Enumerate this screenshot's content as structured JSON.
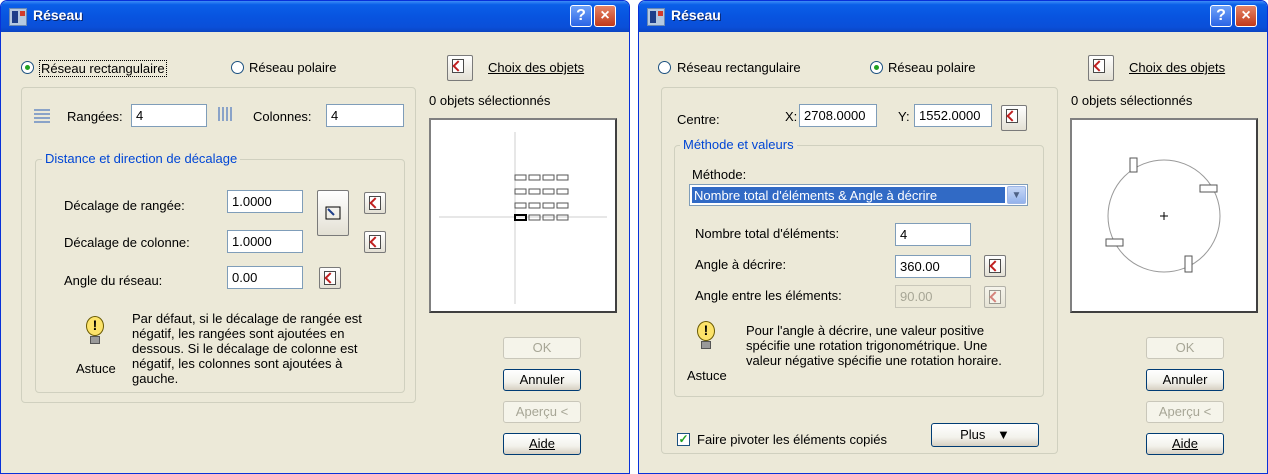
{
  "dialog_rect": {
    "title": "Réseau",
    "help_button": "?",
    "close_button": "×",
    "mode": {
      "rect": "Réseau rectangulaire",
      "polar": "Réseau polaire",
      "selected": "rect"
    },
    "select_objects": "Choix des objets",
    "selection_count": "0 objets sélectionnés",
    "rows_label": "Rangées:",
    "rows_value": "4",
    "cols_label": "Colonnes:",
    "cols_value": "4",
    "group_title": "Distance et direction de décalage",
    "row_offset_label": "Décalage de rangée:",
    "row_offset_value": "1.0000",
    "col_offset_label": "Décalage de colonne:",
    "col_offset_value": "1.0000",
    "angle_label": "Angle du réseau:",
    "angle_value": "0.00",
    "tip_label": "Astuce",
    "tip_text": "Par défaut, si le décalage de rangée est\nnégatif, les rangées sont ajoutées en\ndessous. Si le décalage de colonne est\nnégatif, les colonnes sont ajoutées à\ngauche.",
    "buttons": {
      "ok": "OK",
      "cancel": "Annuler",
      "preview": "Aperçu <",
      "help": "Aide"
    }
  },
  "dialog_polar": {
    "title": "Réseau",
    "help_button": "?",
    "close_button": "×",
    "mode": {
      "rect": "Réseau rectangulaire",
      "polar": "Réseau polaire",
      "selected": "polar"
    },
    "select_objects": "Choix des objets",
    "selection_count": "0 objets sélectionnés",
    "center_label": "Centre:",
    "x_label": "X:",
    "x_value": "2708.0000",
    "y_label": "Y:",
    "y_value": "1552.0000",
    "group_title": "Méthode et valeurs",
    "method_label": "Méthode:",
    "method_value": "Nombre total d'éléments & Angle à décrire",
    "total_label": "Nombre total d'éléments:",
    "total_value": "4",
    "fill_angle_label": "Angle à décrire:",
    "fill_angle_value": "360.00",
    "between_label": "Angle entre les éléments:",
    "between_value": "90.00",
    "tip_label": "Astuce",
    "tip_text": "Pour l'angle à décrire, une valeur positive\nspécifie une rotation trigonométrique. Une\nvaleur négative spécifie une rotation horaire.",
    "rotate_label": "Faire pivoter les éléments copiés",
    "rotate_checked": true,
    "more_button": "Plus",
    "more_icon": "double-chevron-down",
    "buttons": {
      "ok": "OK",
      "cancel": "Annuler",
      "preview": "Aperçu <",
      "help": "Aide"
    }
  },
  "colors": {
    "titlebar": "#0a5fe8",
    "face": "#ece9d8",
    "group_title": "#0046d5",
    "selection": "#316ac5"
  }
}
